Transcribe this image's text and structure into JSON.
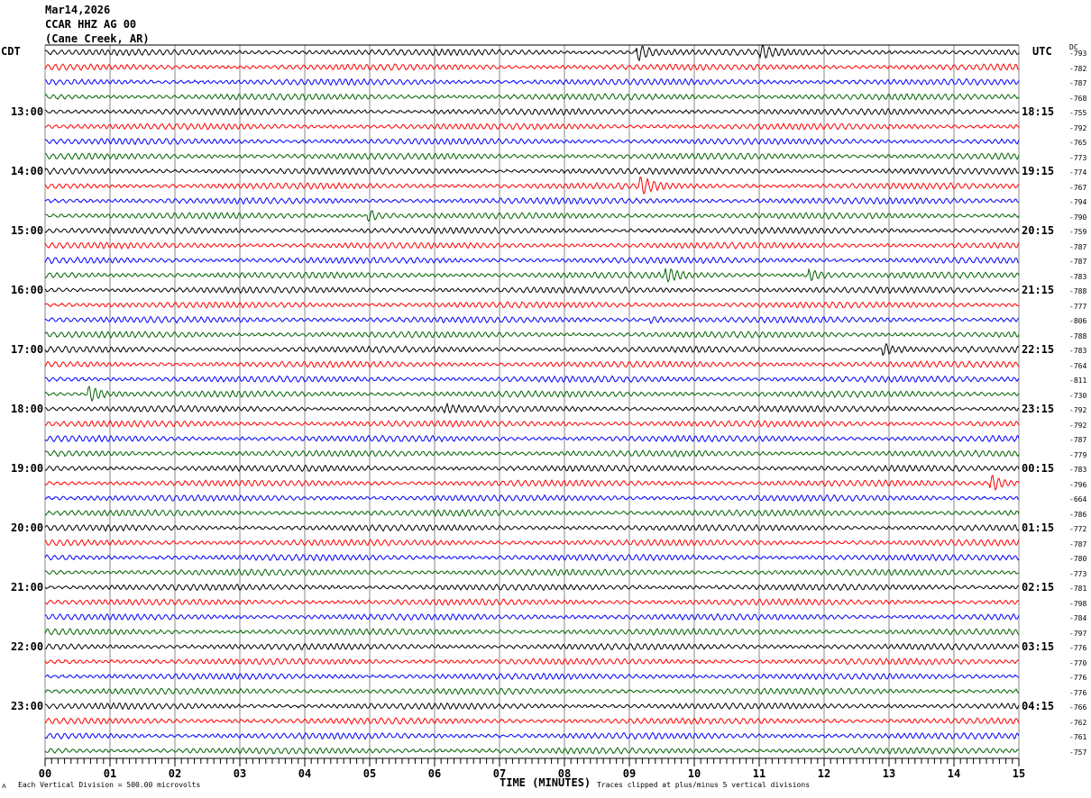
{
  "header": {
    "date": "Mar14,2026",
    "station": "CCAR HHZ AG 00",
    "location": "(Cane Creek, AR)"
  },
  "left_axis": {
    "title": "CDT",
    "labels": [
      "13:00",
      "14:00",
      "15:00",
      "16:00",
      "17:00",
      "18:00",
      "19:00",
      "20:00",
      "21:00",
      "22:00",
      "23:00"
    ]
  },
  "right_axis": {
    "title": "UTC",
    "labels": [
      "18:15",
      "19:15",
      "20:15",
      "21:15",
      "22:15",
      "23:15",
      "00:15",
      "01:15",
      "02:15",
      "03:15",
      "04:15"
    ],
    "dc_title": "DC",
    "dc_values": [
      "-793",
      "-782",
      "-787",
      "-768",
      "-755",
      "-792",
      "-765",
      "-773",
      "-774",
      "-767",
      "-794",
      "-790",
      "-759",
      "-787",
      "-787",
      "-783",
      "-788",
      "-777",
      "-806",
      "-788",
      "-783",
      "-764",
      "-811",
      "-730",
      "-792",
      "-792",
      "-787",
      "-779",
      "-783",
      "-796",
      "-664",
      "-786",
      "-772",
      "-787",
      "-780",
      "-773",
      "-781",
      "-798",
      "-784",
      "-797",
      "-776",
      "-770",
      "-776",
      "-776",
      "-766",
      "-762",
      "-761",
      "-757"
    ]
  },
  "footer": {
    "scale": "Each Vertical Division =  500.00 microvolts",
    "xlabel": "TIME (MINUTES)",
    "clip_note": "Traces clipped at plus/minus 5 vertical divisions"
  },
  "chart_data": {
    "type": "line",
    "subtype": "helicorder",
    "xlabel": "TIME (MINUTES)",
    "xlim": [
      0,
      15
    ],
    "x_ticks": [
      "00",
      "01",
      "02",
      "03",
      "04",
      "05",
      "06",
      "07",
      "08",
      "09",
      "10",
      "11",
      "12",
      "13",
      "14",
      "15"
    ],
    "trace_minutes": 15,
    "trace_count": 48,
    "trace_colors": [
      "#000000",
      "#ff0000",
      "#0000ff",
      "#006400"
    ],
    "grid": true,
    "events": [
      {
        "trace": 0,
        "minute": 9.15,
        "strength": 3
      },
      {
        "trace": 0,
        "minute": 11.05,
        "strength": 2
      },
      {
        "trace": 9,
        "minute": 9.2,
        "strength": 3
      },
      {
        "trace": 11,
        "minute": 5.0,
        "strength": 2
      },
      {
        "trace": 15,
        "minute": 9.6,
        "strength": 2
      },
      {
        "trace": 15,
        "minute": 11.8,
        "strength": 2
      },
      {
        "trace": 18,
        "minute": 9.35,
        "strength": 1
      },
      {
        "trace": 20,
        "minute": 12.95,
        "strength": 2
      },
      {
        "trace": 23,
        "minute": 0.7,
        "strength": 3
      },
      {
        "trace": 24,
        "minute": 6.2,
        "strength": 1
      },
      {
        "trace": 29,
        "minute": 14.6,
        "strength": 3
      }
    ]
  }
}
